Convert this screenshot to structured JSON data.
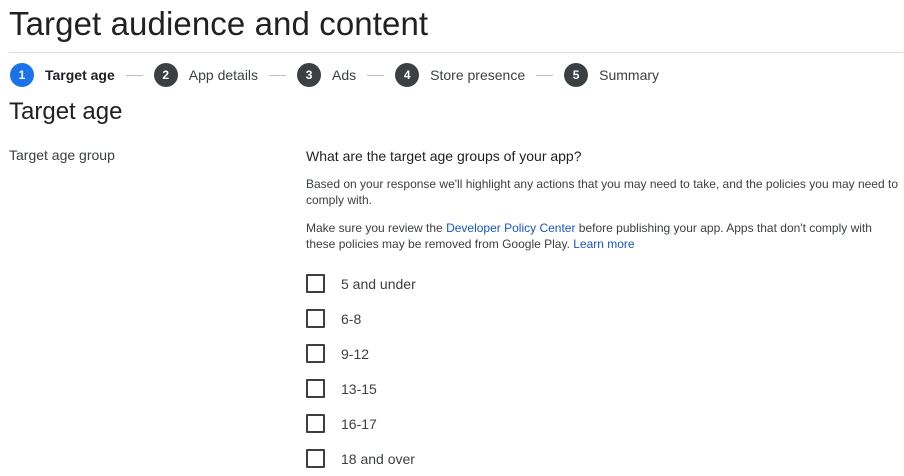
{
  "page": {
    "title": "Target audience and content"
  },
  "stepper": {
    "steps": [
      {
        "number": "1",
        "label": "Target age",
        "active": true
      },
      {
        "number": "2",
        "label": "App details",
        "active": false
      },
      {
        "number": "3",
        "label": "Ads",
        "active": false
      },
      {
        "number": "4",
        "label": "Store presence",
        "active": false
      },
      {
        "number": "5",
        "label": "Summary",
        "active": false
      }
    ]
  },
  "section": {
    "title": "Target age",
    "field_label": "Target age group",
    "question": "What are the target age groups of your app?",
    "description": "Based on your response we'll highlight any actions that you may need to take, and the policies you may need to comply with.",
    "policy_prefix": "Make sure you review the ",
    "policy_link": "Developer Policy Center",
    "policy_suffix": " before publishing your app. Apps that don't comply with these policies may be removed from Google Play. ",
    "learn_more": "Learn more"
  },
  "age_groups": [
    {
      "label": "5 and under",
      "checked": false
    },
    {
      "label": "6-8",
      "checked": false
    },
    {
      "label": "9-12",
      "checked": false
    },
    {
      "label": "13-15",
      "checked": false
    },
    {
      "label": "16-17",
      "checked": false
    },
    {
      "label": "18 and over",
      "checked": false
    }
  ],
  "colors": {
    "accent": "#1a73e8",
    "step_inactive": "#3c4043",
    "link": "#1a55c4",
    "divider": "#dadce0"
  }
}
